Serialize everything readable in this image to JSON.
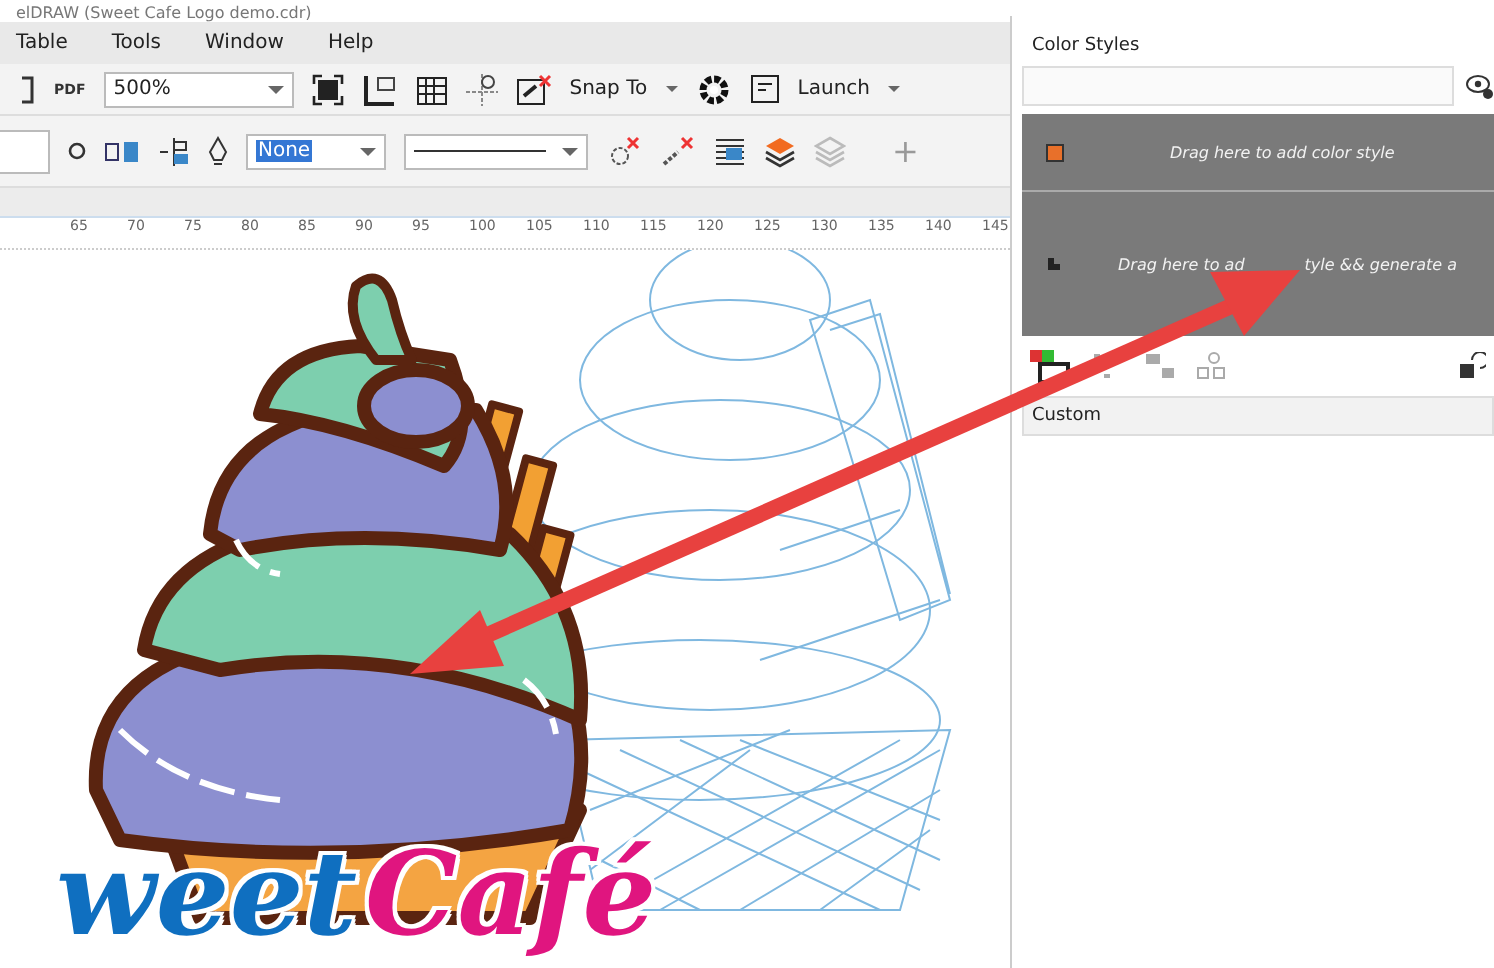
{
  "window": {
    "title": "elDRAW (Sweet Cafe Logo demo.cdr)"
  },
  "menu": [
    {
      "label": "Table"
    },
    {
      "label": "Tools"
    },
    {
      "label": "Window"
    },
    {
      "label": "Help"
    }
  ],
  "toolbar": {
    "pdf_label": "PDF",
    "zoom": "500%",
    "snap": "Snap To",
    "launch": "Launch"
  },
  "property_bar": {
    "outline": "None",
    "add": "+"
  },
  "ruler": [
    "65",
    "70",
    "75",
    "80",
    "85",
    "90",
    "95",
    "100",
    "105",
    "110",
    "115",
    "120",
    "125",
    "130",
    "135",
    "140",
    "145"
  ],
  "canvas": {
    "logo_part_1": "weet",
    "logo_part_2": "Café"
  },
  "docker": {
    "title": "Color Styles",
    "drop_row_1": "Drag here to add color style",
    "drop_row_2_left": "Drag here to ad",
    "drop_row_2_right": "tyle && generate a",
    "section": "Custom"
  }
}
